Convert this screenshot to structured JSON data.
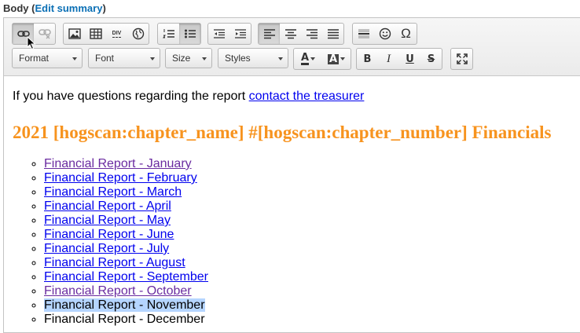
{
  "field": {
    "label": "Body",
    "open_paren": "(",
    "link": "Edit summary",
    "close_paren": ")"
  },
  "toolbar": {
    "row1": [
      [
        "link-icon",
        "unlink-icon"
      ],
      [
        "image-icon",
        "table-icon",
        "div-icon",
        "globe-icon"
      ],
      [
        "numbered-list-icon",
        "bulleted-list-icon"
      ],
      [
        "outdent-icon",
        "indent-icon"
      ],
      [
        "align-left-icon",
        "align-center-icon",
        "align-right-icon",
        "align-justify-icon"
      ],
      [
        "horizontal-rule-icon",
        "smiley-icon",
        "omega-icon"
      ]
    ],
    "format_label": "Format",
    "font_label": "Font",
    "size_label": "Size",
    "styles_label": "Styles",
    "text_color_glyph": "A",
    "bg_color_glyph": "A",
    "bold_glyph": "B",
    "italic_glyph": "I",
    "underline_glyph": "U",
    "strike_glyph": "S",
    "div_glyph": "DIV",
    "omega_glyph": "Ω"
  },
  "content": {
    "intro_text": "If you have questions regarding the report ",
    "intro_link": "contact the treasurer",
    "heading": "2021 [hogscan:chapter_name] #[hogscan:chapter_number] Financials",
    "reports": [
      {
        "label": "Financial Report - January",
        "state": "visited"
      },
      {
        "label": "Financial Report - February",
        "state": "link"
      },
      {
        "label": "Financial Report - March",
        "state": "link"
      },
      {
        "label": "Financial Report - April",
        "state": "link"
      },
      {
        "label": "Financial Report - May",
        "state": "link"
      },
      {
        "label": "Financial Report - June",
        "state": "link"
      },
      {
        "label": "Financial Report - July",
        "state": "link"
      },
      {
        "label": "Financial Report - August",
        "state": "link"
      },
      {
        "label": "Financial Report - September",
        "state": "link"
      },
      {
        "label": "Financial Report - October",
        "state": "visited"
      },
      {
        "label": "Financial Report - November",
        "state": "selected"
      },
      {
        "label": "Financial Report - December",
        "state": "plain"
      }
    ]
  },
  "colors": {
    "heading": "#f7931e",
    "link": "#0000ee",
    "visited": "#6a2ba0",
    "selection": "#b5d5ff"
  }
}
